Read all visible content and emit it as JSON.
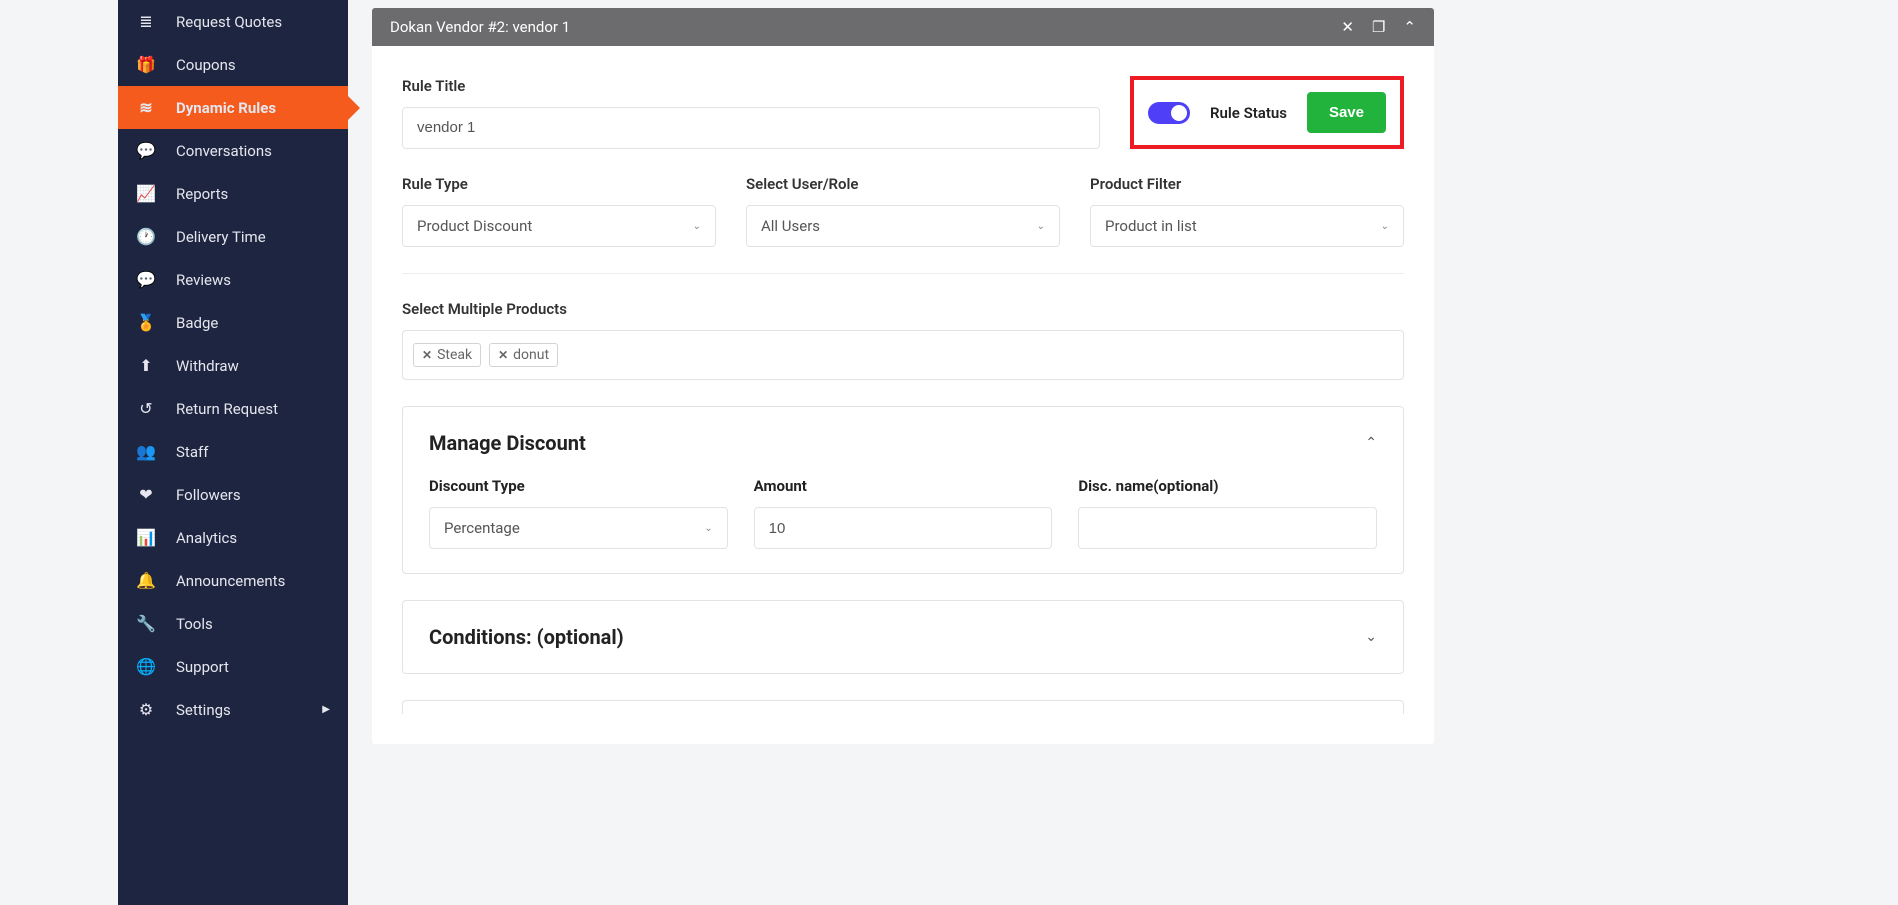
{
  "sidebar": {
    "items": [
      {
        "label": "Request Quotes",
        "icon": "≣"
      },
      {
        "label": "Coupons",
        "icon": "🎁"
      },
      {
        "label": "Dynamic Rules",
        "icon": "≋",
        "active": true
      },
      {
        "label": "Conversations",
        "icon": "💬"
      },
      {
        "label": "Reports",
        "icon": "📈"
      },
      {
        "label": "Delivery Time",
        "icon": "🕐"
      },
      {
        "label": "Reviews",
        "icon": "💬"
      },
      {
        "label": "Badge",
        "icon": "🏅"
      },
      {
        "label": "Withdraw",
        "icon": "⬆"
      },
      {
        "label": "Return Request",
        "icon": "↺"
      },
      {
        "label": "Staff",
        "icon": "👥"
      },
      {
        "label": "Followers",
        "icon": "❤"
      },
      {
        "label": "Analytics",
        "icon": "📊"
      },
      {
        "label": "Announcements",
        "icon": "🔔"
      },
      {
        "label": "Tools",
        "icon": "🔧"
      },
      {
        "label": "Support",
        "icon": "🌐"
      },
      {
        "label": "Settings",
        "icon": "⚙",
        "submenu": true
      }
    ]
  },
  "panel": {
    "title": "Dokan Vendor #2: vendor 1"
  },
  "form": {
    "rule_title_label": "Rule Title",
    "rule_title_value": "vendor 1",
    "rule_status_label": "Rule Status",
    "rule_status_on": true,
    "save_label": "Save",
    "rule_type_label": "Rule Type",
    "rule_type_value": "Product Discount",
    "user_role_label": "Select User/Role",
    "user_role_value": "All Users",
    "product_filter_label": "Product Filter",
    "product_filter_value": "Product in list",
    "products_label": "Select Multiple Products",
    "products": [
      "Steak",
      "donut"
    ]
  },
  "discount": {
    "section_title": "Manage Discount",
    "type_label": "Discount Type",
    "type_value": "Percentage",
    "amount_label": "Amount",
    "amount_value": "10",
    "name_label": "Disc. name(optional)",
    "name_value": ""
  },
  "conditions": {
    "section_title": "Conditions: (optional)"
  }
}
